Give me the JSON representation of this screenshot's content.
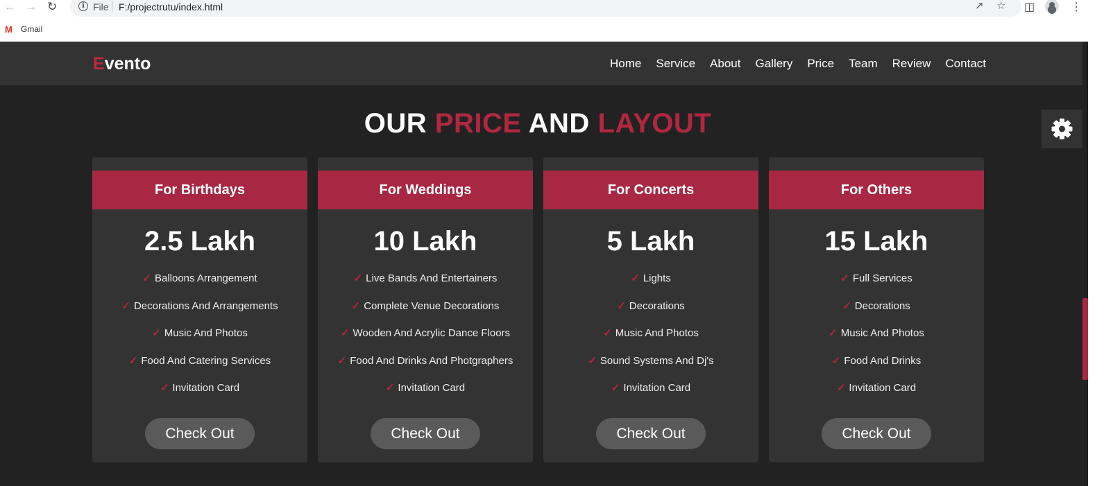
{
  "browser": {
    "file_label": "File",
    "url": "F:/projectrutu/index.html",
    "bookmark_label": "Gmail"
  },
  "site": {
    "logo_first": "E",
    "logo_rest": "vento",
    "nav": [
      "Home",
      "Service",
      "About",
      "Gallery",
      "Price",
      "Team",
      "Review",
      "Contact"
    ]
  },
  "heading": {
    "part1": "OUR ",
    "part2": "PRICE",
    "part3": " AND ",
    "part4": "LAYOUT"
  },
  "plans": [
    {
      "title": "For Birthdays",
      "price": "2.5 Lakh",
      "features": [
        "Balloons Arrangement",
        "Decorations And Arrangements",
        "Music And Photos",
        "Food And Catering Services",
        "Invitation Card"
      ],
      "button": "Check Out"
    },
    {
      "title": "For Weddings",
      "price": "10 Lakh",
      "features": [
        "Live Bands And Entertainers",
        "Complete Venue Decorations",
        "Wooden And Acrylic Dance Floors",
        "Food And Drinks And Photgraphers",
        "Invitation Card"
      ],
      "button": "Check Out"
    },
    {
      "title": "For Concerts",
      "price": "5 Lakh",
      "features": [
        "Lights",
        "Decorations",
        "Music And Photos",
        "Sound Systems And Dj's",
        "Invitation Card"
      ],
      "button": "Check Out"
    },
    {
      "title": "For Others",
      "price": "15 Lakh",
      "features": [
        "Full Services",
        "Decorations",
        "Music And Photos",
        "Food And Drinks",
        "Invitation Card"
      ],
      "button": "Check Out"
    }
  ],
  "icons": {
    "back": "arrow-left-icon",
    "forward": "arrow-right-icon",
    "reload": "reload-icon",
    "settings": "gear-icon"
  },
  "colors": {
    "accent": "#a82843",
    "background": "#222222",
    "card": "#333333"
  }
}
